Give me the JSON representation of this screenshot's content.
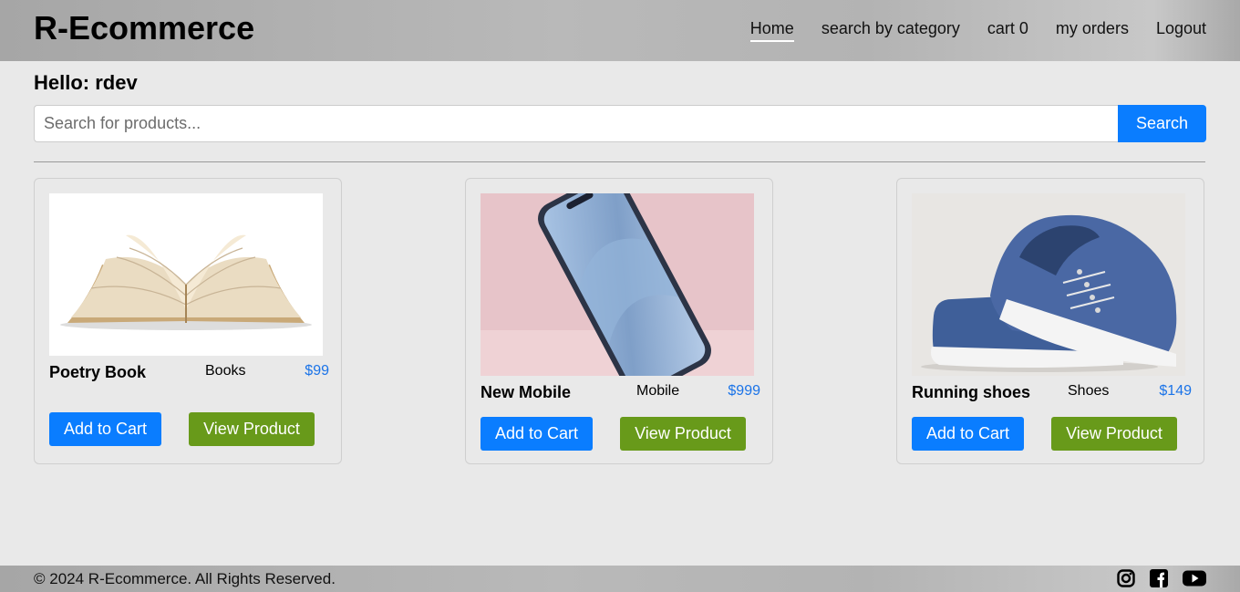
{
  "nav": {
    "brand": "R-Ecommerce",
    "links": [
      {
        "label": "Home",
        "active": true
      },
      {
        "label": "search by category"
      },
      {
        "label": "cart 0"
      },
      {
        "label": "my orders"
      },
      {
        "label": "Logout"
      }
    ]
  },
  "greeting": "Hello: rdev",
  "search": {
    "placeholder": "Search for products...",
    "value": "",
    "button_label": "Search"
  },
  "products": [
    {
      "name": "Poetry Book",
      "category": "Books",
      "price": "$99",
      "image_icon": "open-book-image",
      "add_label": "Add to Cart",
      "view_label": "View Product"
    },
    {
      "name": "New Mobile",
      "category": "Mobile",
      "price": "$999",
      "image_icon": "smartphone-image",
      "add_label": "Add to Cart",
      "view_label": "View Product"
    },
    {
      "name": "Running shoes",
      "category": "Shoes",
      "price": "$149",
      "image_icon": "blue-sneakers-image",
      "add_label": "Add to Cart",
      "view_label": "View Product"
    }
  ],
  "footer": {
    "text": "© 2024 R-Ecommerce. All Rights Reserved.",
    "social_icons": [
      "instagram-icon",
      "facebook-icon",
      "youtube-icon"
    ]
  },
  "colors": {
    "primary": "#0a7dff",
    "success": "#689a1a",
    "price": "#1a73e8",
    "background": "#e9e9e9"
  }
}
